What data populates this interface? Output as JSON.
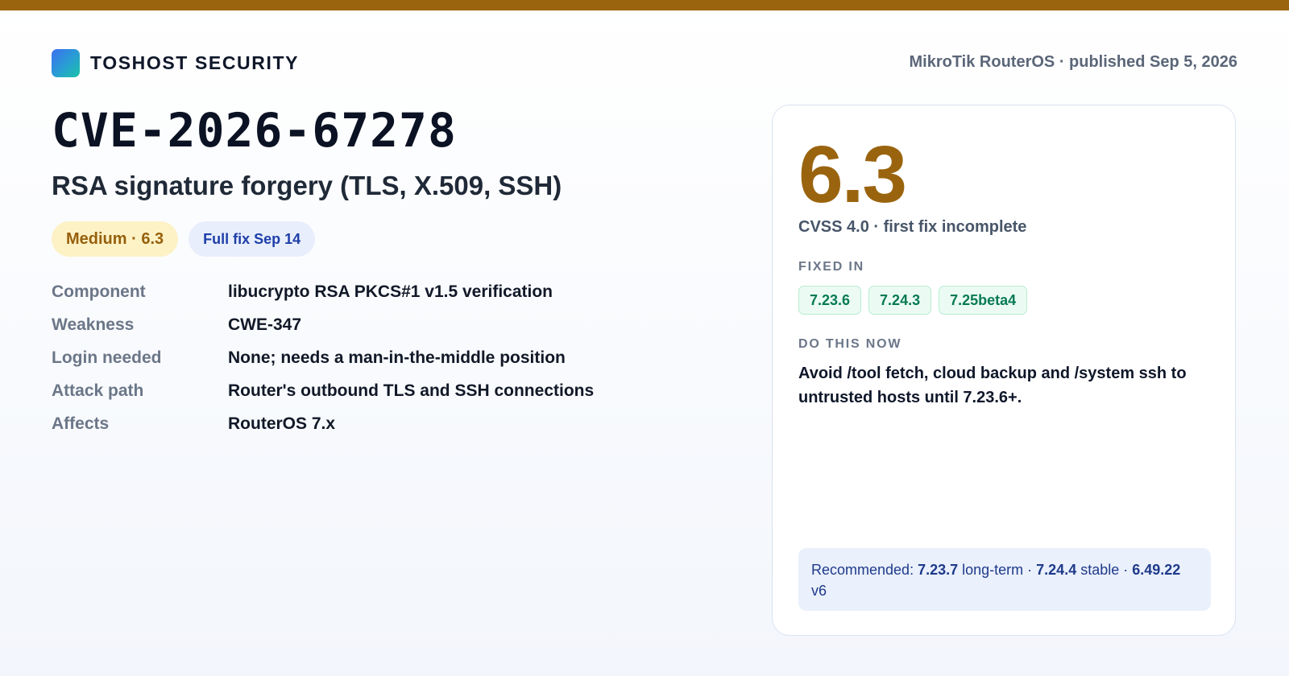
{
  "colors": {
    "accent": "#9a640f",
    "severity_bg": "#fdf2c6",
    "fix_badge_bg": "#e8eefc",
    "version_chip_bg": "#ebfbf3",
    "recommend_bg": "#eaf0fc"
  },
  "header": {
    "logo_icon": "gradient-square-logo-icon",
    "brand": "TOSHOST SECURITY",
    "meta": "MikroTik RouterOS · published Sep 5, 2026"
  },
  "advisory": {
    "cve_id": "CVE-2026-67278",
    "title": "RSA signature forgery (TLS, X.509, SSH)",
    "badges": {
      "severity": "Medium · 6.3",
      "fix": "Full fix Sep 14"
    },
    "details": [
      {
        "label": "Component",
        "value": "libucrypto RSA PKCS#1 v1.5 verification"
      },
      {
        "label": "Weakness",
        "value": "CWE-347"
      },
      {
        "label": "Login needed",
        "value": "None; needs a man-in-the-middle position"
      },
      {
        "label": "Attack path",
        "value": "Router's outbound TLS and SSH connections"
      },
      {
        "label": "Affects",
        "value": "RouterOS 7.x"
      }
    ]
  },
  "panel": {
    "score": "6.3",
    "score_caption": "CVSS 4.0 · first fix incomplete",
    "fixed_in_label": "FIXED IN",
    "fixed_in": [
      "7.23.6",
      "7.24.3",
      "7.25beta4"
    ],
    "do_now_label": "DO THIS NOW",
    "do_now_text": "Avoid /tool fetch, cloud backup and /system ssh to untrusted hosts until 7.23.6+.",
    "recommended": {
      "prefix": "Recommended: ",
      "longterm_version": "7.23.7",
      "longterm_label": " long-term · ",
      "stable_version": "7.24.4",
      "stable_label": " stable · ",
      "v6_version": "6.49.22",
      "v6_label": " v6"
    }
  }
}
